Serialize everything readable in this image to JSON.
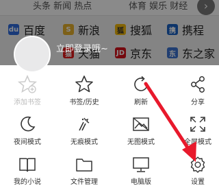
{
  "browser": {
    "search_hint_left": "头条 新闻 热点",
    "search_hint_right": "体育 娱乐 财经",
    "close_glyph": "›",
    "sites_row1": [
      {
        "label": "百度",
        "color": "#2f6bde",
        "glyph": "du"
      },
      {
        "label": "新浪",
        "color": "#e8b12e",
        "glyph": "S"
      },
      {
        "label": "搜狐",
        "color": "#f2b90c",
        "glyph": "狐"
      },
      {
        "label": "携程",
        "color": "#1b63c5",
        "glyph": "携"
      }
    ],
    "sites_row2": [
      {
        "label": "天猫",
        "color": "#e31b1b",
        "glyph": "猫"
      },
      {
        "label": "京东",
        "color": "#d6121a",
        "glyph": "JD"
      },
      {
        "label": "东之家",
        "color": "#3b74d1",
        "glyph": "东"
      }
    ]
  },
  "menu": {
    "login_text": "立即登录哦~",
    "items": [
      {
        "label": "添加书签",
        "icon": "star-add-icon",
        "disabled": true
      },
      {
        "label": "书签/历史",
        "icon": "star-icon",
        "disabled": false
      },
      {
        "label": "刷新",
        "icon": "refresh-icon",
        "disabled": false
      },
      {
        "label": "分享",
        "icon": "share-icon",
        "disabled": false
      },
      {
        "label": "夜间模式",
        "icon": "moon-icon",
        "disabled": false
      },
      {
        "label": "无痕模式",
        "icon": "incognito-icon",
        "disabled": false
      },
      {
        "label": "无图模式",
        "icon": "no-image-icon",
        "disabled": false
      },
      {
        "label": "全屏模式",
        "icon": "fullscreen-icon",
        "disabled": false
      },
      {
        "label": "我的小说",
        "icon": "book-icon",
        "disabled": false
      },
      {
        "label": "文件管理",
        "icon": "folder-icon",
        "disabled": false
      },
      {
        "label": "电脑版",
        "icon": "monitor-icon",
        "disabled": false
      },
      {
        "label": "设置",
        "icon": "gear-icon",
        "disabled": false
      }
    ]
  },
  "annotation": {
    "arrow_color": "#e8192c",
    "target": "设置"
  }
}
